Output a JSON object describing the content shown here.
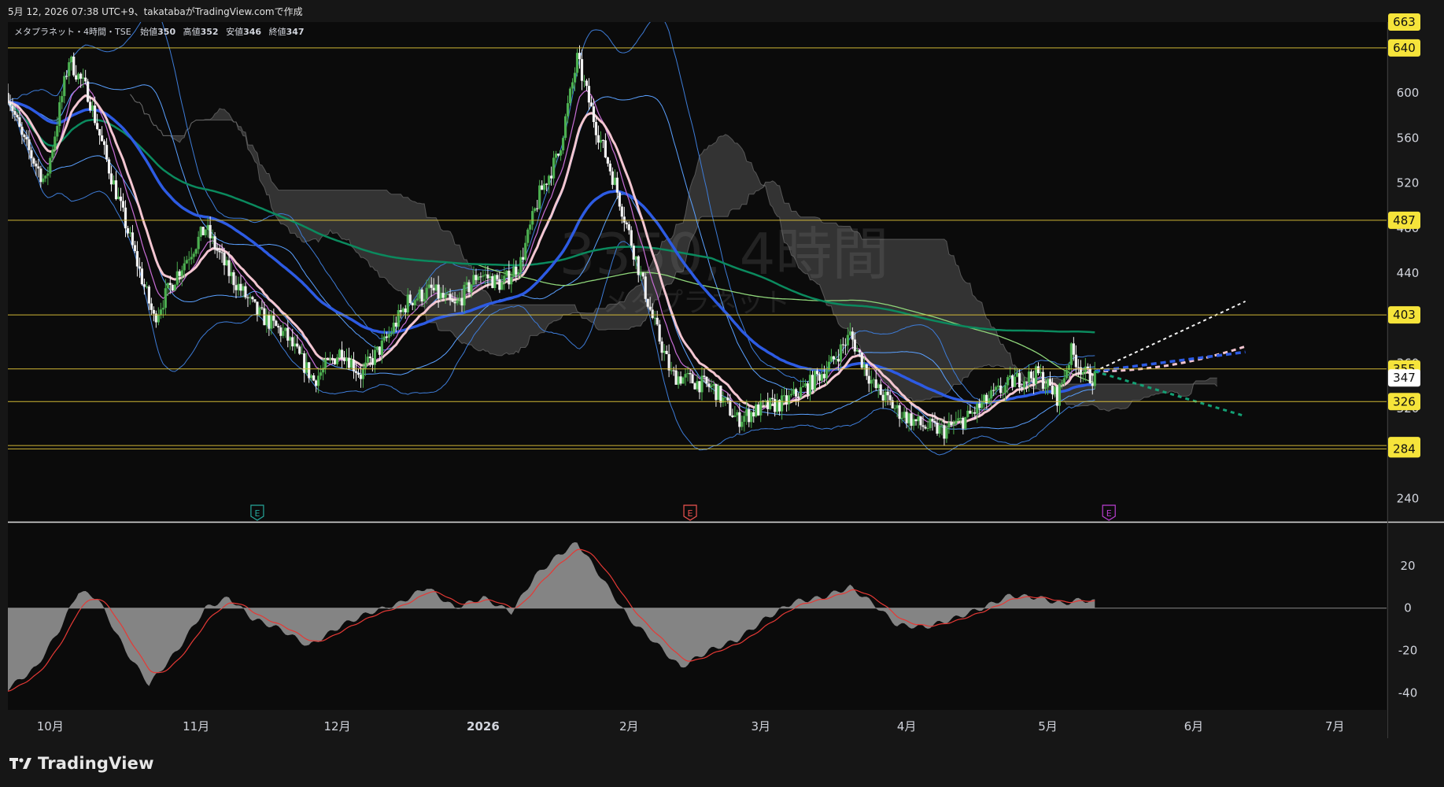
{
  "caption": "5月 12, 2026 07:38 UTC+9、takatabaがTradingView.comで作成",
  "brand": "TradingView",
  "watermark": {
    "line1": "3350, 4時間",
    "line2": "メタプラネット"
  },
  "legend": {
    "name": "メタプラネット・4時間・TSE",
    "open_label": "始値",
    "open": "350",
    "high_label": "高値",
    "high": "352",
    "low_label": "安値",
    "low": "346",
    "close_label": "終値",
    "close": "347"
  },
  "chart_data": [
    {
      "type": "candlestick",
      "y_axis": {
        "min": 220,
        "max": 663,
        "ticks": [
          240,
          280,
          320,
          360,
          400,
          440,
          480,
          520,
          560,
          600
        ]
      },
      "x_axis": {
        "range": [
          "2025-09-22",
          "2026-07-12"
        ],
        "labels": [
          {
            "label": "10月",
            "date": "2025-10-01"
          },
          {
            "label": "11月",
            "date": "2025-11-01"
          },
          {
            "label": "12月",
            "date": "2025-12-01"
          },
          {
            "label": "2026",
            "date": "2026-01-01",
            "bold": true
          },
          {
            "label": "2月",
            "date": "2026-02-01"
          },
          {
            "label": "3月",
            "date": "2026-03-01"
          },
          {
            "label": "4月",
            "date": "2026-04-01"
          },
          {
            "label": "5月",
            "date": "2026-05-01"
          },
          {
            "label": "6月",
            "date": "2026-06-01"
          },
          {
            "label": "7月",
            "date": "2026-07-01"
          }
        ]
      },
      "horizontal_levels": [
        640,
        487,
        403,
        355,
        326,
        287,
        284
      ],
      "price_tags": [
        {
          "value": 663,
          "label": "663",
          "style": "yellow"
        },
        {
          "value": 640,
          "label": "640",
          "style": "yellow"
        },
        {
          "value": 487,
          "label": "487",
          "style": "yellow"
        },
        {
          "value": 403,
          "label": "403",
          "style": "yellow"
        },
        {
          "value": 355,
          "label": "355",
          "style": "yellow"
        },
        {
          "value": 347,
          "label": "347",
          "style": "white"
        },
        {
          "value": 326,
          "label": "326",
          "style": "yellow"
        },
        {
          "value": 287,
          "label": "287",
          "style": "yellow"
        },
        {
          "value": 284,
          "label": "284",
          "style": "yellow"
        }
      ],
      "event_markers": [
        {
          "date": "2025-11-14",
          "label": "E",
          "color": "#26a69a"
        },
        {
          "date": "2026-02-14",
          "label": "E",
          "color": "#ef5350"
        },
        {
          "date": "2026-05-14",
          "label": "E",
          "color": "#ba3fd1"
        }
      ],
      "price_path": [
        [
          "2025-09-22",
          600
        ],
        [
          "2025-09-25",
          560
        ],
        [
          "2025-09-30",
          520
        ],
        [
          "2025-10-05",
          630
        ],
        [
          "2025-10-09",
          600
        ],
        [
          "2025-10-13",
          540
        ],
        [
          "2025-10-18",
          470
        ],
        [
          "2025-10-23",
          400
        ],
        [
          "2025-10-28",
          440
        ],
        [
          "2025-11-03",
          480
        ],
        [
          "2025-11-08",
          440
        ],
        [
          "2025-11-14",
          405
        ],
        [
          "2025-11-20",
          385
        ],
        [
          "2025-11-26",
          345
        ],
        [
          "2025-12-02",
          372
        ],
        [
          "2025-12-06",
          350
        ],
        [
          "2025-12-11",
          378
        ],
        [
          "2025-12-16",
          415
        ],
        [
          "2025-12-21",
          425
        ],
        [
          "2025-12-26",
          410
        ],
        [
          "2025-12-31",
          440
        ],
        [
          "2026-01-05",
          430
        ],
        [
          "2026-01-09",
          450
        ],
        [
          "2026-01-13",
          510
        ],
        [
          "2026-01-17",
          545
        ],
        [
          "2026-01-21",
          630
        ],
        [
          "2026-01-25",
          570
        ],
        [
          "2026-01-29",
          520
        ],
        [
          "2026-02-02",
          460
        ],
        [
          "2026-02-06",
          400
        ],
        [
          "2026-02-10",
          350
        ],
        [
          "2026-02-14",
          345
        ],
        [
          "2026-02-19",
          338
        ],
        [
          "2026-02-24",
          310
        ],
        [
          "2026-03-01",
          320
        ],
        [
          "2026-03-06",
          325
        ],
        [
          "2026-03-11",
          340
        ],
        [
          "2026-03-16",
          360
        ],
        [
          "2026-03-20",
          385
        ],
        [
          "2026-03-25",
          340
        ],
        [
          "2026-03-30",
          318
        ],
        [
          "2026-04-04",
          305
        ],
        [
          "2026-04-09",
          300
        ],
        [
          "2026-04-14",
          312
        ],
        [
          "2026-04-19",
          330
        ],
        [
          "2026-04-24",
          345
        ],
        [
          "2026-04-29",
          350
        ],
        [
          "2026-05-03",
          330
        ],
        [
          "2026-05-06",
          370
        ],
        [
          "2026-05-09",
          350
        ],
        [
          "2026-05-11",
          347
        ]
      ],
      "oscillator": {
        "y_axis": {
          "min": -48,
          "max": 40,
          "ticks": [
            20,
            0,
            -20,
            -40
          ]
        },
        "histogram_path": [
          [
            "2025-09-22",
            -38
          ],
          [
            "2025-09-28",
            -28
          ],
          [
            "2025-10-03",
            -10
          ],
          [
            "2025-10-07",
            8
          ],
          [
            "2025-10-11",
            5
          ],
          [
            "2025-10-17",
            -20
          ],
          [
            "2025-10-22",
            -36
          ],
          [
            "2025-10-28",
            -20
          ],
          [
            "2025-11-03",
            0
          ],
          [
            "2025-11-08",
            5
          ],
          [
            "2025-11-13",
            -5
          ],
          [
            "2025-11-19",
            -10
          ],
          [
            "2025-11-25",
            -18
          ],
          [
            "2025-12-02",
            -8
          ],
          [
            "2025-12-08",
            -2
          ],
          [
            "2025-12-14",
            2
          ],
          [
            "2025-12-20",
            10
          ],
          [
            "2025-12-26",
            0
          ],
          [
            "2026-01-01",
            5
          ],
          [
            "2026-01-07",
            -2
          ],
          [
            "2026-01-12",
            15
          ],
          [
            "2026-01-17",
            25
          ],
          [
            "2026-01-21",
            31
          ],
          [
            "2026-01-26",
            15
          ],
          [
            "2026-02-01",
            -5
          ],
          [
            "2026-02-06",
            -15
          ],
          [
            "2026-02-12",
            -28
          ],
          [
            "2026-02-18",
            -20
          ],
          [
            "2026-02-24",
            -15
          ],
          [
            "2026-03-02",
            -5
          ],
          [
            "2026-03-08",
            3
          ],
          [
            "2026-03-14",
            5
          ],
          [
            "2026-03-20",
            10
          ],
          [
            "2026-03-25",
            2
          ],
          [
            "2026-03-30",
            -8
          ],
          [
            "2026-04-05",
            -9
          ],
          [
            "2026-04-11",
            -5
          ],
          [
            "2026-04-17",
            0
          ],
          [
            "2026-04-23",
            6
          ],
          [
            "2026-04-29",
            5
          ],
          [
            "2026-05-04",
            2
          ],
          [
            "2026-05-08",
            4
          ],
          [
            "2026-05-11",
            3
          ]
        ]
      }
    }
  ]
}
